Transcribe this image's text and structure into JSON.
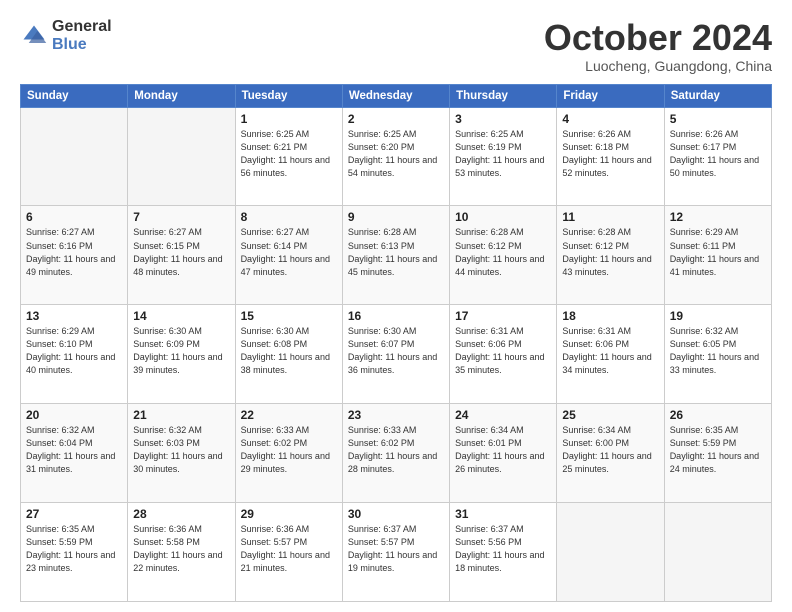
{
  "logo": {
    "general": "General",
    "blue": "Blue"
  },
  "header": {
    "month": "October 2024",
    "location": "Luocheng, Guangdong, China"
  },
  "weekdays": [
    "Sunday",
    "Monday",
    "Tuesday",
    "Wednesday",
    "Thursday",
    "Friday",
    "Saturday"
  ],
  "weeks": [
    [
      {
        "day": "",
        "sunrise": "",
        "sunset": "",
        "daylight": ""
      },
      {
        "day": "",
        "sunrise": "",
        "sunset": "",
        "daylight": ""
      },
      {
        "day": "1",
        "sunrise": "Sunrise: 6:25 AM",
        "sunset": "Sunset: 6:21 PM",
        "daylight": "Daylight: 11 hours and 56 minutes."
      },
      {
        "day": "2",
        "sunrise": "Sunrise: 6:25 AM",
        "sunset": "Sunset: 6:20 PM",
        "daylight": "Daylight: 11 hours and 54 minutes."
      },
      {
        "day": "3",
        "sunrise": "Sunrise: 6:25 AM",
        "sunset": "Sunset: 6:19 PM",
        "daylight": "Daylight: 11 hours and 53 minutes."
      },
      {
        "day": "4",
        "sunrise": "Sunrise: 6:26 AM",
        "sunset": "Sunset: 6:18 PM",
        "daylight": "Daylight: 11 hours and 52 minutes."
      },
      {
        "day": "5",
        "sunrise": "Sunrise: 6:26 AM",
        "sunset": "Sunset: 6:17 PM",
        "daylight": "Daylight: 11 hours and 50 minutes."
      }
    ],
    [
      {
        "day": "6",
        "sunrise": "Sunrise: 6:27 AM",
        "sunset": "Sunset: 6:16 PM",
        "daylight": "Daylight: 11 hours and 49 minutes."
      },
      {
        "day": "7",
        "sunrise": "Sunrise: 6:27 AM",
        "sunset": "Sunset: 6:15 PM",
        "daylight": "Daylight: 11 hours and 48 minutes."
      },
      {
        "day": "8",
        "sunrise": "Sunrise: 6:27 AM",
        "sunset": "Sunset: 6:14 PM",
        "daylight": "Daylight: 11 hours and 47 minutes."
      },
      {
        "day": "9",
        "sunrise": "Sunrise: 6:28 AM",
        "sunset": "Sunset: 6:13 PM",
        "daylight": "Daylight: 11 hours and 45 minutes."
      },
      {
        "day": "10",
        "sunrise": "Sunrise: 6:28 AM",
        "sunset": "Sunset: 6:12 PM",
        "daylight": "Daylight: 11 hours and 44 minutes."
      },
      {
        "day": "11",
        "sunrise": "Sunrise: 6:28 AM",
        "sunset": "Sunset: 6:12 PM",
        "daylight": "Daylight: 11 hours and 43 minutes."
      },
      {
        "day": "12",
        "sunrise": "Sunrise: 6:29 AM",
        "sunset": "Sunset: 6:11 PM",
        "daylight": "Daylight: 11 hours and 41 minutes."
      }
    ],
    [
      {
        "day": "13",
        "sunrise": "Sunrise: 6:29 AM",
        "sunset": "Sunset: 6:10 PM",
        "daylight": "Daylight: 11 hours and 40 minutes."
      },
      {
        "day": "14",
        "sunrise": "Sunrise: 6:30 AM",
        "sunset": "Sunset: 6:09 PM",
        "daylight": "Daylight: 11 hours and 39 minutes."
      },
      {
        "day": "15",
        "sunrise": "Sunrise: 6:30 AM",
        "sunset": "Sunset: 6:08 PM",
        "daylight": "Daylight: 11 hours and 38 minutes."
      },
      {
        "day": "16",
        "sunrise": "Sunrise: 6:30 AM",
        "sunset": "Sunset: 6:07 PM",
        "daylight": "Daylight: 11 hours and 36 minutes."
      },
      {
        "day": "17",
        "sunrise": "Sunrise: 6:31 AM",
        "sunset": "Sunset: 6:06 PM",
        "daylight": "Daylight: 11 hours and 35 minutes."
      },
      {
        "day": "18",
        "sunrise": "Sunrise: 6:31 AM",
        "sunset": "Sunset: 6:06 PM",
        "daylight": "Daylight: 11 hours and 34 minutes."
      },
      {
        "day": "19",
        "sunrise": "Sunrise: 6:32 AM",
        "sunset": "Sunset: 6:05 PM",
        "daylight": "Daylight: 11 hours and 33 minutes."
      }
    ],
    [
      {
        "day": "20",
        "sunrise": "Sunrise: 6:32 AM",
        "sunset": "Sunset: 6:04 PM",
        "daylight": "Daylight: 11 hours and 31 minutes."
      },
      {
        "day": "21",
        "sunrise": "Sunrise: 6:32 AM",
        "sunset": "Sunset: 6:03 PM",
        "daylight": "Daylight: 11 hours and 30 minutes."
      },
      {
        "day": "22",
        "sunrise": "Sunrise: 6:33 AM",
        "sunset": "Sunset: 6:02 PM",
        "daylight": "Daylight: 11 hours and 29 minutes."
      },
      {
        "day": "23",
        "sunrise": "Sunrise: 6:33 AM",
        "sunset": "Sunset: 6:02 PM",
        "daylight": "Daylight: 11 hours and 28 minutes."
      },
      {
        "day": "24",
        "sunrise": "Sunrise: 6:34 AM",
        "sunset": "Sunset: 6:01 PM",
        "daylight": "Daylight: 11 hours and 26 minutes."
      },
      {
        "day": "25",
        "sunrise": "Sunrise: 6:34 AM",
        "sunset": "Sunset: 6:00 PM",
        "daylight": "Daylight: 11 hours and 25 minutes."
      },
      {
        "day": "26",
        "sunrise": "Sunrise: 6:35 AM",
        "sunset": "Sunset: 5:59 PM",
        "daylight": "Daylight: 11 hours and 24 minutes."
      }
    ],
    [
      {
        "day": "27",
        "sunrise": "Sunrise: 6:35 AM",
        "sunset": "Sunset: 5:59 PM",
        "daylight": "Daylight: 11 hours and 23 minutes."
      },
      {
        "day": "28",
        "sunrise": "Sunrise: 6:36 AM",
        "sunset": "Sunset: 5:58 PM",
        "daylight": "Daylight: 11 hours and 22 minutes."
      },
      {
        "day": "29",
        "sunrise": "Sunrise: 6:36 AM",
        "sunset": "Sunset: 5:57 PM",
        "daylight": "Daylight: 11 hours and 21 minutes."
      },
      {
        "day": "30",
        "sunrise": "Sunrise: 6:37 AM",
        "sunset": "Sunset: 5:57 PM",
        "daylight": "Daylight: 11 hours and 19 minutes."
      },
      {
        "day": "31",
        "sunrise": "Sunrise: 6:37 AM",
        "sunset": "Sunset: 5:56 PM",
        "daylight": "Daylight: 11 hours and 18 minutes."
      },
      {
        "day": "",
        "sunrise": "",
        "sunset": "",
        "daylight": ""
      },
      {
        "day": "",
        "sunrise": "",
        "sunset": "",
        "daylight": ""
      }
    ]
  ]
}
